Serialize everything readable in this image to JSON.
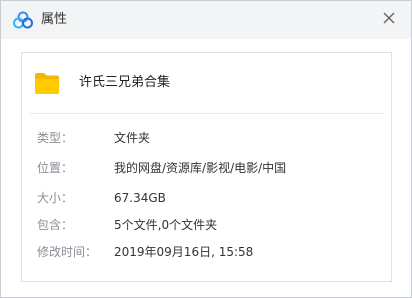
{
  "window": {
    "title": "属性",
    "close_icon": "close-icon"
  },
  "item": {
    "name": "许氏三兄弟合集",
    "icon": "folder-icon",
    "icon_color": "#ffcc00"
  },
  "properties": [
    {
      "label": "类型：",
      "value": "文件夹"
    },
    {
      "label": "位置：",
      "value": "我的网盘/资源库/影视/电影/中国"
    },
    {
      "label": "大小：",
      "value": "67.34GB"
    },
    {
      "label": "包含：",
      "value": "5个文件,0个文件夹"
    },
    {
      "label": "修改时间：",
      "value": "2019年09月16日, 15:58"
    }
  ]
}
